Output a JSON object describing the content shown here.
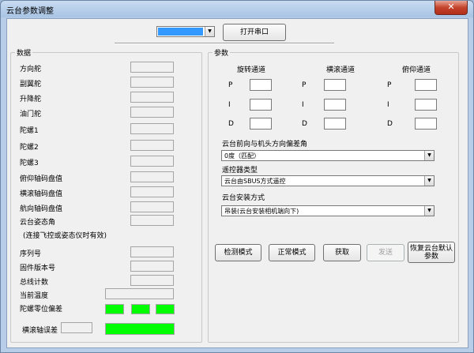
{
  "window": {
    "title": "云台参数调整",
    "close_glyph": "✕"
  },
  "toolbar": {
    "port_value": "",
    "open_port_label": "打开串口"
  },
  "data_panel": {
    "title": "数据",
    "rows": [
      {
        "label": "方向舵",
        "value": ""
      },
      {
        "label": "副翼舵",
        "value": ""
      },
      {
        "label": "升降舵",
        "value": ""
      },
      {
        "label": "油门舵",
        "value": ""
      },
      {
        "label": "陀螺1",
        "value": ""
      },
      {
        "label": "陀螺2",
        "value": ""
      },
      {
        "label": "陀螺3",
        "value": ""
      },
      {
        "label": "俯仰轴码盘值",
        "value": ""
      },
      {
        "label": "横滚轴码盘值",
        "value": ""
      },
      {
        "label": "航向轴码盘值",
        "value": ""
      },
      {
        "label": "云台姿态角",
        "value": ""
      },
      {
        "label": "序列号",
        "value": ""
      },
      {
        "label": "固件版本号",
        "value": ""
      },
      {
        "label": "总线计数",
        "value": ""
      }
    ],
    "attitude_note": "(连接飞控或姿态仪时有效)",
    "current_temp_label": "当前温度",
    "current_temp_value": "",
    "gyro_offset_label": "陀螺零位偏差",
    "roll_error_label": "横滚轴误差",
    "roll_error_value": ""
  },
  "params_panel": {
    "title": "参数",
    "channels": [
      {
        "title": "旋转通道",
        "p": "",
        "i": "",
        "d": ""
      },
      {
        "title": "横滚通道",
        "p": "",
        "i": "",
        "d": ""
      },
      {
        "title": "俯仰通道",
        "p": "",
        "i": "",
        "d": ""
      }
    ],
    "p_label": "P",
    "i_label": "I",
    "d_label": "D",
    "offset_label": "云台前向与机头方向偏差角",
    "offset_value": "0度（匹配）",
    "remote_label": "遥控器类型",
    "remote_value": "云台由SBUS方式遥控",
    "mount_label": "云台安装方式",
    "mount_value": "吊装(云台安装相机端向下)",
    "buttons": {
      "detect": "检测模式",
      "normal": "正常模式",
      "fetch": "获取",
      "send": "发送",
      "restore_line1": "恢复云台默认",
      "restore_line2": "参数"
    }
  },
  "colors": {
    "indicator": "#00ff00",
    "selection": "#3399ff"
  }
}
